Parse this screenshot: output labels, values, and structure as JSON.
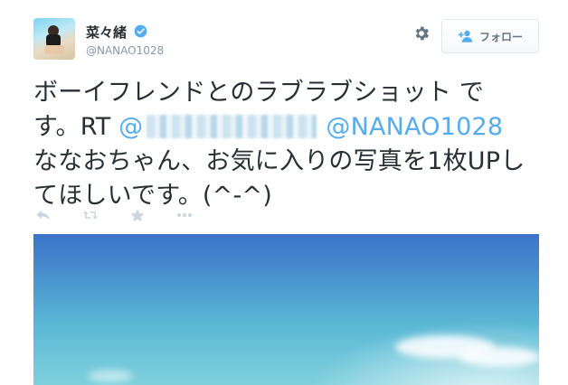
{
  "user": {
    "display_name": "菜々緒",
    "screen_name": "@NANAO1028",
    "verified": true
  },
  "follow_button": {
    "label": "フォロー",
    "icon": "follow-user-icon"
  },
  "settings_icon": "gear-icon",
  "tweet": {
    "line1": "ボーイフレンドとのラブラブショット で",
    "line2_prefix": "す。RT ",
    "mention_hidden": "@",
    "mention_visible": "@NANAO1028",
    "line3": "ななおちゃん、お気に入りの写真を1枚UPし",
    "line4": "てほしいです。(^-^)"
  },
  "actions": [
    {
      "name": "reply",
      "icon": "reply-icon"
    },
    {
      "name": "retweet",
      "icon": "retweet-icon"
    },
    {
      "name": "favorite",
      "icon": "star-icon"
    },
    {
      "name": "more",
      "icon": "more-dots-icon"
    }
  ],
  "colors": {
    "text": "#292f33",
    "link": "#55acee",
    "muted": "#8899a6",
    "icon": "#ccd6dd",
    "verified": "#55acee"
  }
}
